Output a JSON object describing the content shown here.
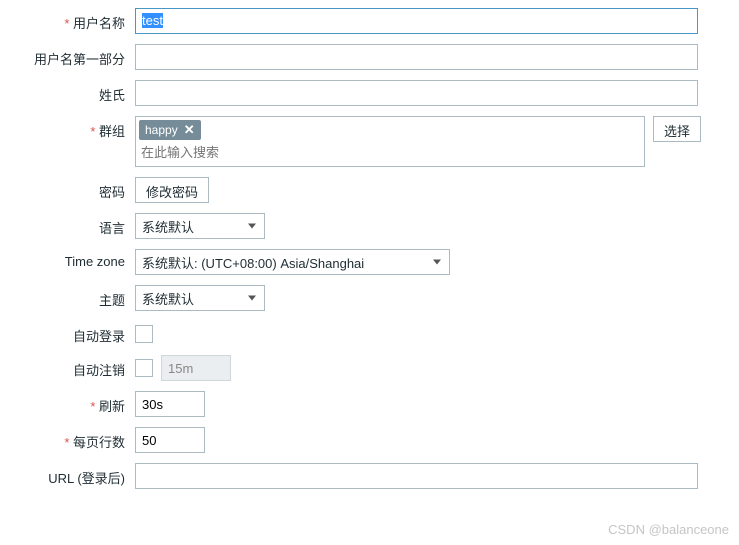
{
  "fields": {
    "username": {
      "label": "用户名称",
      "value": "test"
    },
    "firstname": {
      "label": "用户名第一部分",
      "value": ""
    },
    "lastname": {
      "label": "姓氏",
      "value": ""
    },
    "group": {
      "label": "群组",
      "tag": "happy",
      "search_placeholder": "在此输入搜索",
      "select_btn": "选择"
    },
    "password": {
      "label": "密码",
      "button": "修改密码"
    },
    "language": {
      "label": "语言",
      "value": "系统默认"
    },
    "timezone": {
      "label": "Time zone",
      "value": "系统默认: (UTC+08:00) Asia/Shanghai"
    },
    "theme": {
      "label": "主题",
      "value": "系统默认"
    },
    "autologin": {
      "label": "自动登录"
    },
    "autologout": {
      "label": "自动注销",
      "value": "15m"
    },
    "refresh": {
      "label": "刷新",
      "value": "30s"
    },
    "rows": {
      "label": "每页行数",
      "value": "50"
    },
    "url": {
      "label": "URL (登录后)",
      "value": ""
    }
  },
  "watermark": "CSDN @balanceone"
}
